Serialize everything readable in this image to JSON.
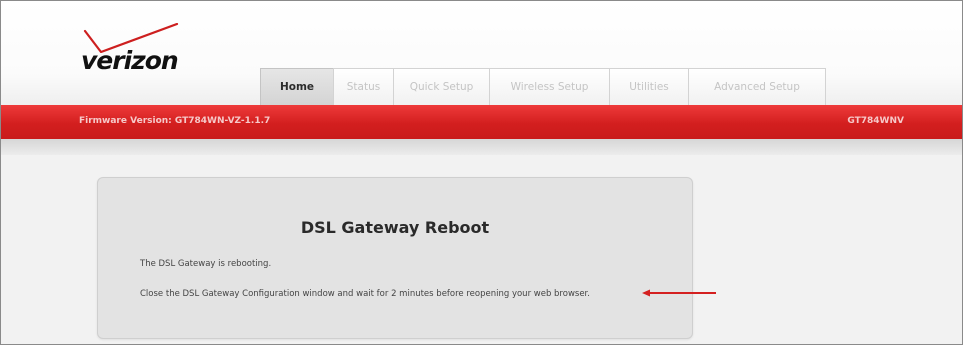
{
  "brand": {
    "logo_text": "verizon",
    "accent": "#d31f1f"
  },
  "nav": {
    "tabs": [
      {
        "label": "Home",
        "active": true
      },
      {
        "label": "Status",
        "active": false
      },
      {
        "label": "Quick Setup",
        "active": false
      },
      {
        "label": "Wireless Setup",
        "active": false
      },
      {
        "label": "Utilities",
        "active": false
      },
      {
        "label": "Advanced Setup",
        "active": false
      }
    ]
  },
  "info_bar": {
    "firmware": "Firmware Version: GT784WN-VZ-1.1.7",
    "model": "GT784WNV"
  },
  "main": {
    "title": "DSL Gateway Reboot",
    "status_text": "The DSL Gateway is rebooting.",
    "instruction_text": "Close the DSL Gateway Configuration window and wait for 2 minutes before reopening your web browser."
  },
  "annotation": {
    "type": "arrow",
    "color": "#d42020"
  }
}
